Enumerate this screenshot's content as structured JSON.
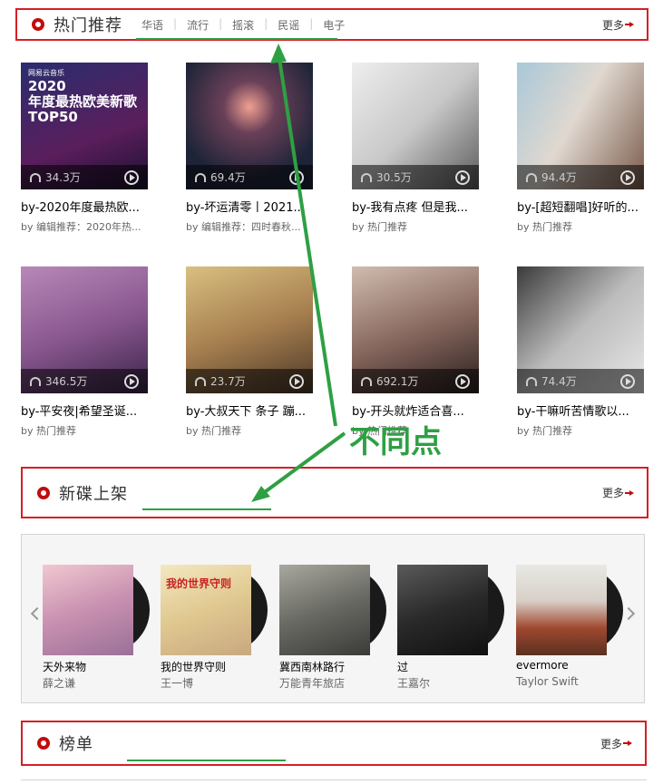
{
  "hot": {
    "title": "热门推荐",
    "tabs": [
      "华语",
      "流行",
      "摇滚",
      "民谣",
      "电子"
    ],
    "more": "更多",
    "playlists": [
      {
        "name": "by-2020年度最热欧...",
        "plays": "34.3万",
        "sub_prefix": "by",
        "sub": "编辑推荐：2020年热...",
        "cover_text": "2020\n年度最热欧美新歌\nTOP50",
        "cover_brand": "网易云音乐"
      },
      {
        "name": "by-坏运清零丨2021...",
        "plays": "69.4万",
        "sub_prefix": "by",
        "sub": "编辑推荐：四时春秋..."
      },
      {
        "name": "by-我有点疼 但是我...",
        "plays": "30.5万",
        "sub_prefix": "by",
        "sub": "热门推荐"
      },
      {
        "name": "by-[超短翻唱]好听的...",
        "plays": "94.4万",
        "sub_prefix": "by",
        "sub": "热门推荐"
      },
      {
        "name": "by-平安夜|希望圣诞...",
        "plays": "346.5万",
        "sub_prefix": "by",
        "sub": "热门推荐"
      },
      {
        "name": "by-大叔天下 条子 蹦...",
        "plays": "23.7万",
        "sub_prefix": "by",
        "sub": "热门推荐"
      },
      {
        "name": "by-开头就炸适合喜...",
        "plays": "692.1万",
        "sub_prefix": "by",
        "sub": "热门推荐"
      },
      {
        "name": "by-干嘛听苦情歌以...",
        "plays": "74.4万",
        "sub_prefix": "by",
        "sub": "热门推荐"
      }
    ]
  },
  "new_albums": {
    "title": "新碟上架",
    "more": "更多",
    "albums": [
      {
        "name": "天外来物",
        "artist": "薛之谦",
        "color": "#d8a8b8"
      },
      {
        "name": "我的世界守则",
        "artist": "王一博",
        "color": "#e8d8b0",
        "cover_text": "我的世界守则"
      },
      {
        "name": "冀西南林路行",
        "artist": "万能青年旅店",
        "color": "#8a8a82"
      },
      {
        "name": "过",
        "artist": "王嘉尔",
        "color": "#2a2a2a"
      },
      {
        "name": "evermore",
        "artist": "Taylor Swift",
        "color": "#c8c0b4"
      }
    ]
  },
  "charts": {
    "title": "榜单",
    "more": "更多"
  },
  "annotation": {
    "text": "不同点"
  }
}
